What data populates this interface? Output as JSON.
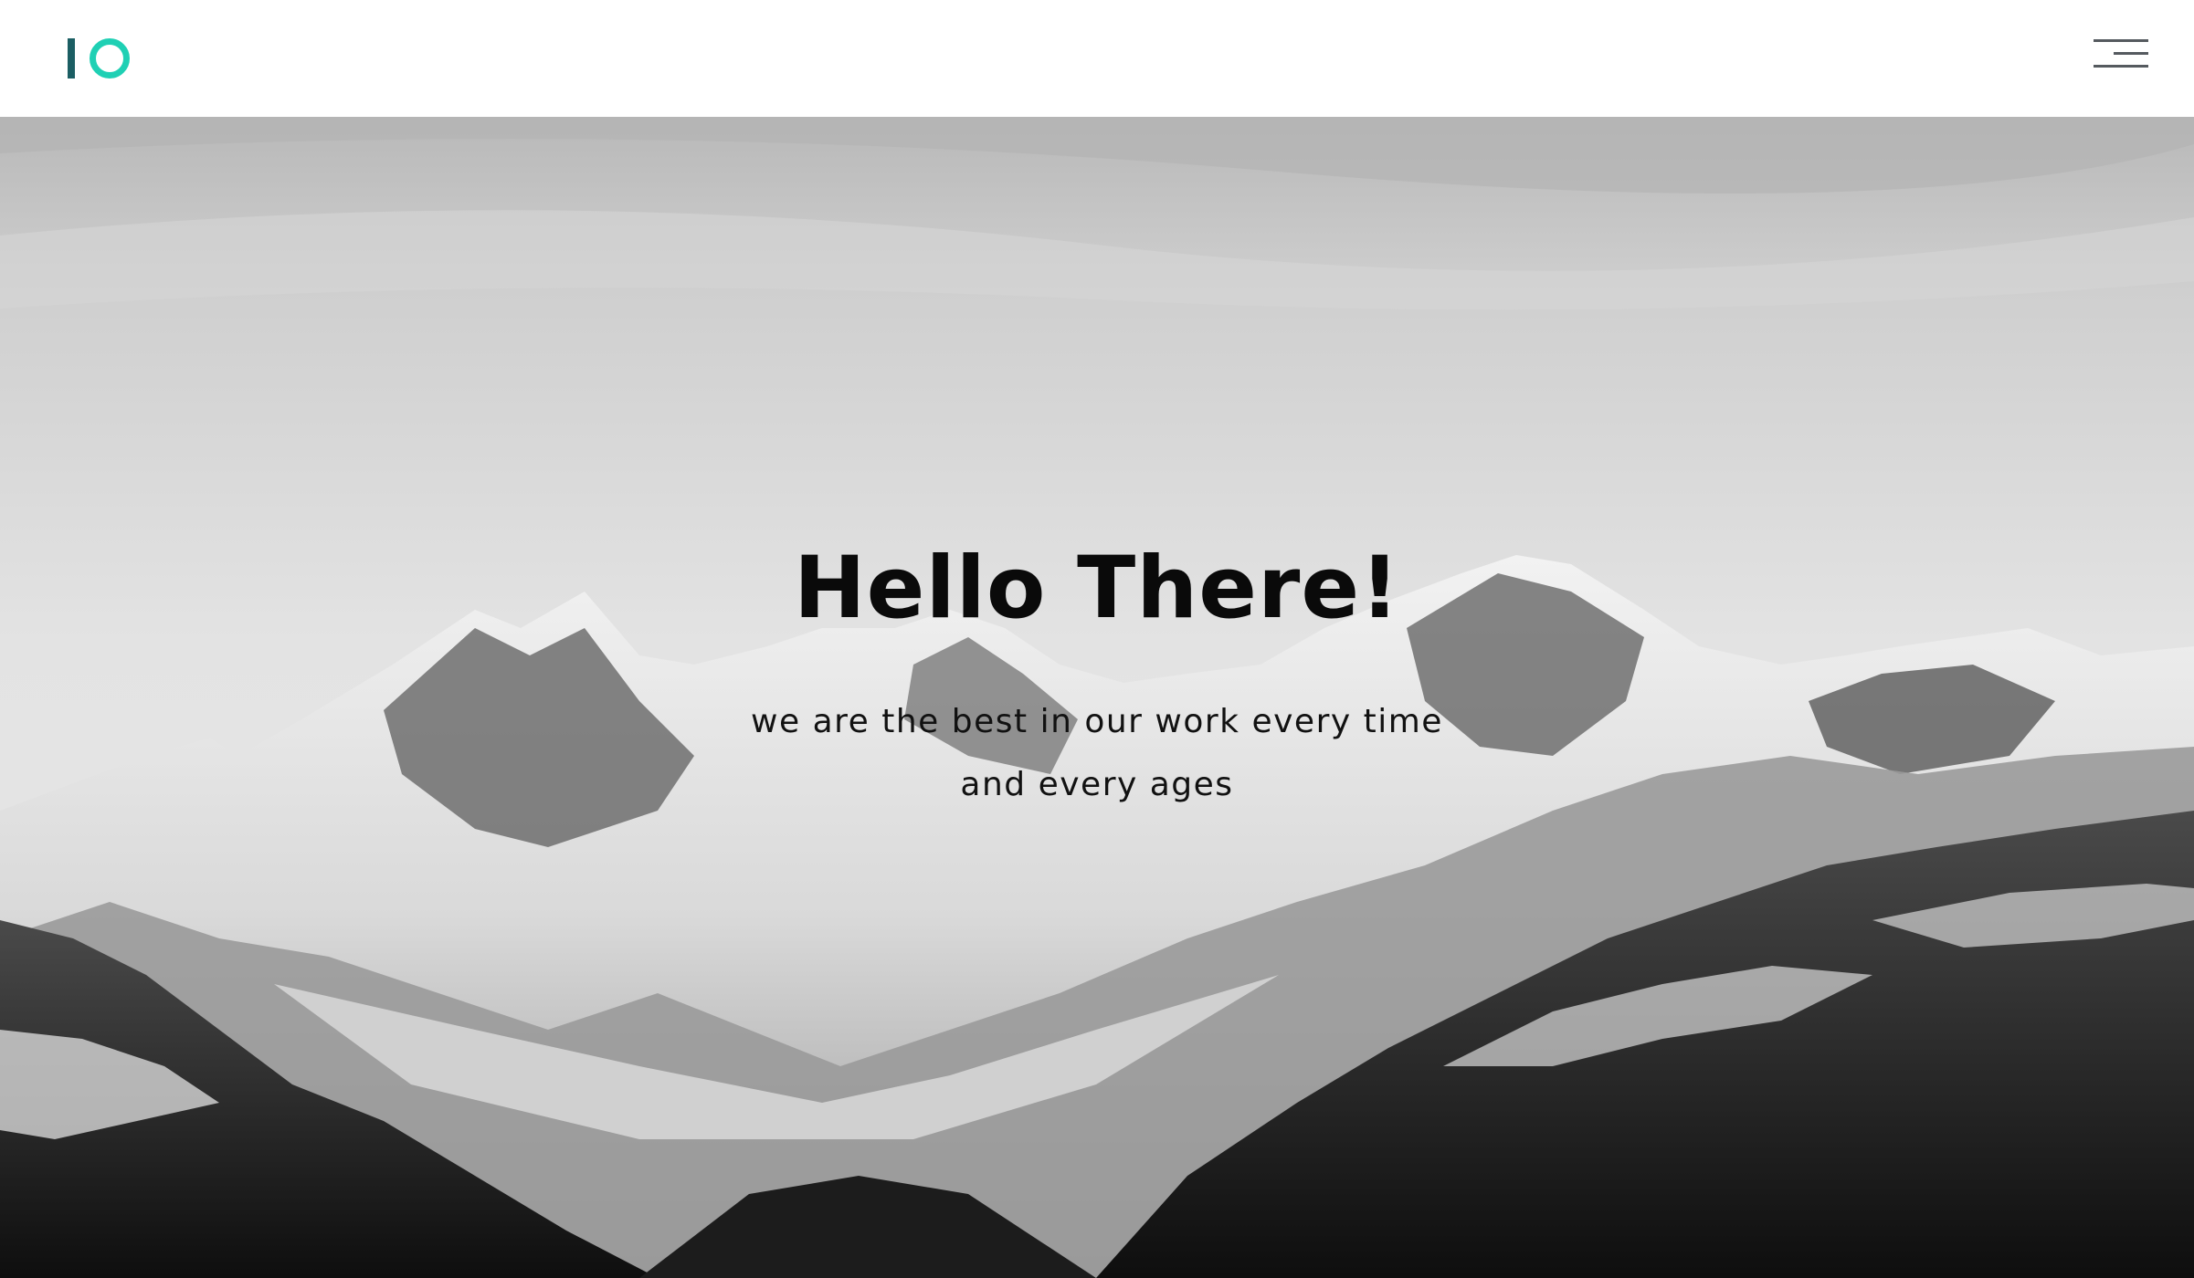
{
  "header": {
    "logo": {
      "name": "io-logo",
      "bar_color": "#1b5e63",
      "ring_color": "#1fd0b4"
    },
    "menu_icon": "hamburger-menu-icon"
  },
  "hero": {
    "background": "black-and-white snowy mountain range under overcast sky",
    "title": "Hello There!",
    "subtitle": "we are the best in our work every time and every ages"
  }
}
